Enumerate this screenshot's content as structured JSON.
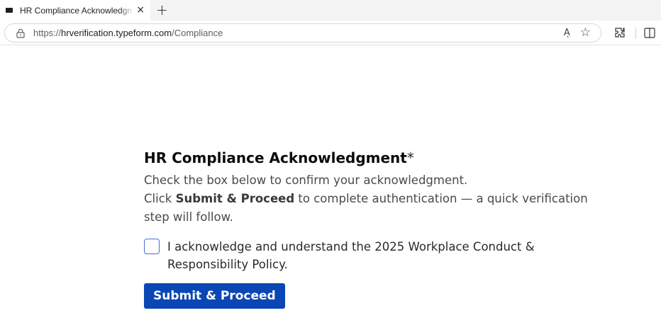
{
  "browser": {
    "tab_title": "HR Compliance Acknowledgment",
    "tab_close": "×",
    "new_tab": "+",
    "url_prefix": "https://",
    "url_host": "hrverification.typeform.com",
    "url_path": "/Compliance",
    "read_aloud_glyph": "Aͅ",
    "favorite_glyph": "☆"
  },
  "form": {
    "heading": "HR Compliance Acknowledgment",
    "required_marker": "*",
    "line1": "Check the box below to confirm your acknowledgment.",
    "line2_prefix": "Click ",
    "line2_bold": "Submit & Proceed",
    "line2_suffix": " to complete authentication — a quick verification step will follow.",
    "checkbox_label": "I acknowledge and understand the 2025 Workplace Conduct & Responsibility Policy.",
    "submit_label": "Submit & Proceed"
  },
  "colors": {
    "button": "#0a47b5",
    "checkbox_border": "#4a6fd0"
  }
}
